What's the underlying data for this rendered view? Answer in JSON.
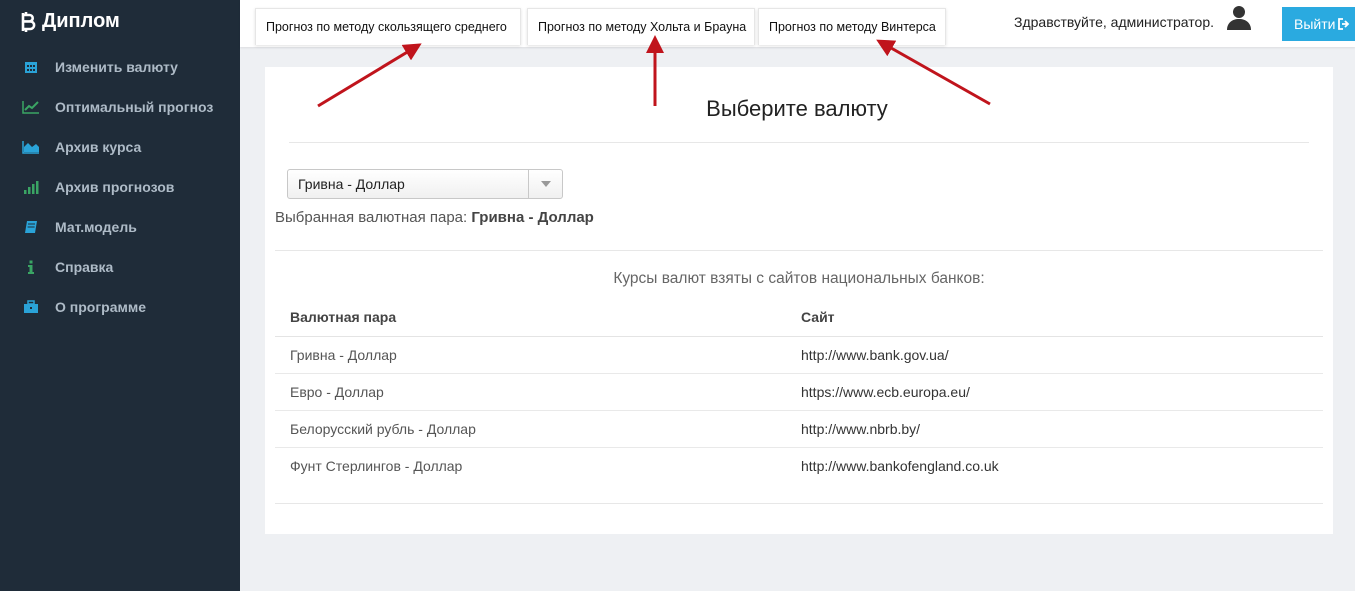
{
  "app": {
    "brand": "Диплом",
    "brand_icon": "bitcoin-icon"
  },
  "sidebar": {
    "items": [
      {
        "label": "Изменить валюту",
        "icon": "calendar-icon"
      },
      {
        "label": "Оптимальный прогноз",
        "icon": "line-chart-icon"
      },
      {
        "label": "Архив курса",
        "icon": "area-chart-icon"
      },
      {
        "label": "Архив прогнозов",
        "icon": "signal-bars-icon"
      },
      {
        "label": "Мат.модель",
        "icon": "book-icon"
      },
      {
        "label": "Справка",
        "icon": "info-icon"
      },
      {
        "label": "О программе",
        "icon": "briefcase-icon"
      }
    ]
  },
  "header": {
    "tabs": [
      {
        "label": "Прогноз по методу скользящего среднего"
      },
      {
        "label": "Прогноз по методу Хольта и Брауна"
      },
      {
        "label": "Прогноз по методу Винтерса"
      }
    ],
    "greeting": "Здравствуйте, администратор.",
    "logout_label": "Выйти",
    "colors": {
      "logout_bg": "#2aaae0",
      "sidebar_bg": "#1f2c39",
      "arrow": "#c0141c"
    }
  },
  "main": {
    "title": "Выберите валюту",
    "currency_select": {
      "selected": "Гривна - Доллар"
    },
    "selected_pair_label": "Выбранная валютная пара:",
    "selected_pair_value": "Гривна - Доллар",
    "source_note": "Курсы валют взяты с сайтов национальных банков:",
    "table": {
      "headers": [
        "Валютная пара",
        "Сайт"
      ],
      "rows": [
        [
          "Гривна - Доллар",
          "http://www.bank.gov.ua/"
        ],
        [
          "Евро - Доллар",
          "https://www.ecb.europa.eu/"
        ],
        [
          "Белорусский рубль - Доллар",
          "http://www.nbrb.by/"
        ],
        [
          "Фунт Стерлингов - Доллар",
          "http://www.bankofengland.co.uk"
        ]
      ]
    }
  }
}
